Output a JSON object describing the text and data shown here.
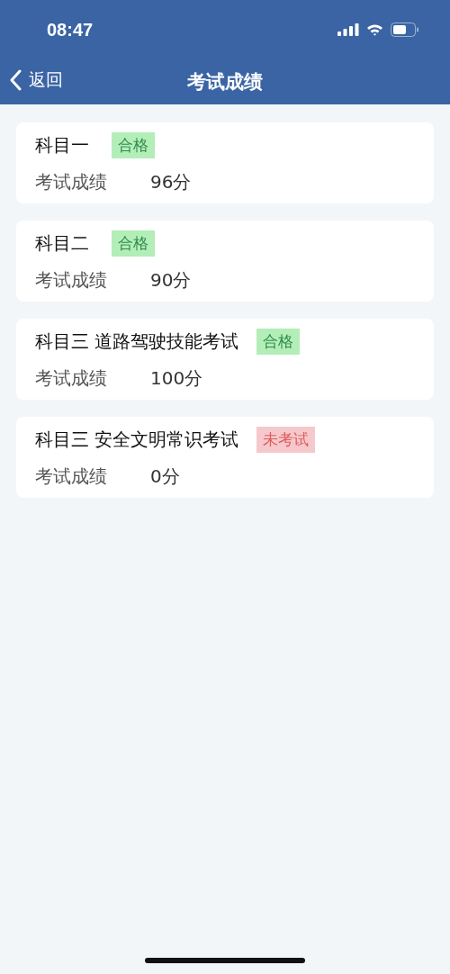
{
  "status_bar": {
    "time": "08:47"
  },
  "nav_bar": {
    "back": "返回",
    "title": "考试成绩"
  },
  "results": [
    {
      "subject": "科目一",
      "status": "合格",
      "kind": "passed",
      "score_label": "考试成绩",
      "score": "96分"
    },
    {
      "subject": "科目二",
      "status": "合格",
      "kind": "passed",
      "score_label": "考试成绩",
      "score": "90分"
    },
    {
      "subject": "科目三 道路驾驶技能考试",
      "status": "合格",
      "kind": "passed",
      "score_label": "考试成绩",
      "score": "100分"
    },
    {
      "subject": "科目三 安全文明常识考试",
      "status": "未考试",
      "kind": "not_taken",
      "score_label": "考试成绩",
      "score": "0分"
    }
  ]
}
